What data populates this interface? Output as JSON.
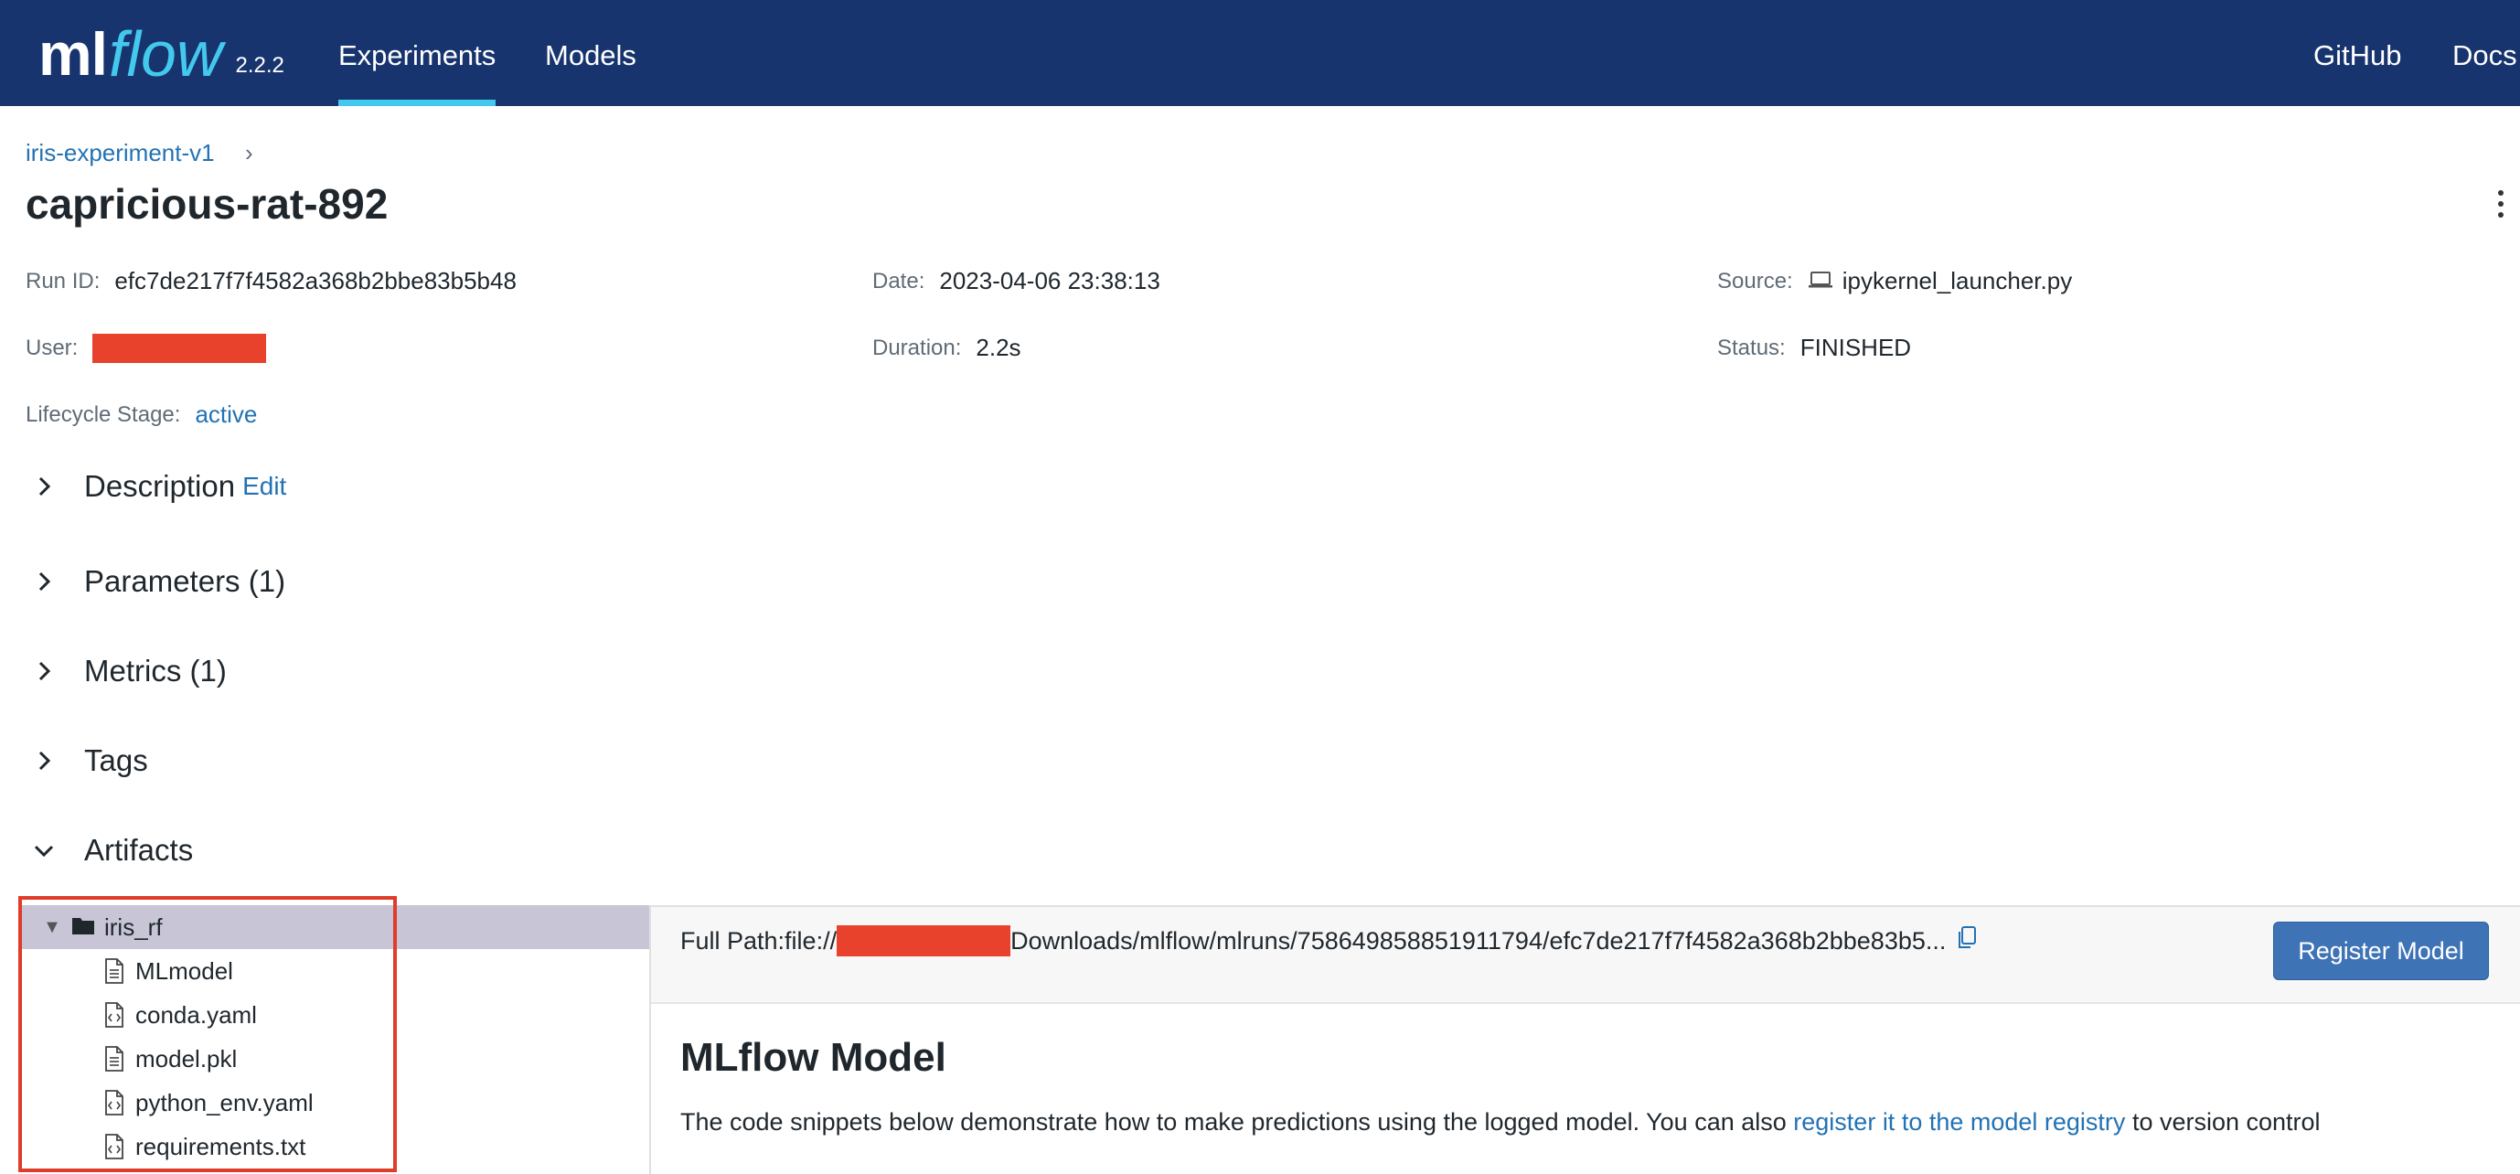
{
  "nav": {
    "logo_ml": "ml",
    "logo_flow": "flow",
    "version": "2.2.2",
    "links": [
      "Experiments",
      "Models"
    ],
    "right_links": [
      "GitHub",
      "Docs"
    ]
  },
  "breadcrumb": {
    "experiment": "iris-experiment-v1",
    "separator": "›"
  },
  "run": {
    "title": "capricious-rat-892",
    "run_id_label": "Run ID:",
    "run_id": "efc7de217f7f4582a368b2bbe83b5b48",
    "date_label": "Date:",
    "date": "2023-04-06 23:38:13",
    "source_label": "Source:",
    "source": "ipykernel_launcher.py",
    "user_label": "User:",
    "duration_label": "Duration:",
    "duration": "2.2s",
    "status_label": "Status:",
    "status": "FINISHED",
    "lifecycle_label": "Lifecycle Stage:",
    "lifecycle": "active"
  },
  "sections": {
    "description": "Description",
    "edit": "Edit",
    "parameters": "Parameters (1)",
    "metrics": "Metrics (1)",
    "tags": "Tags",
    "artifacts": "Artifacts"
  },
  "artifacts": {
    "folder": "iris_rf",
    "files": [
      {
        "name": "MLmodel",
        "icon": "file-text-icon"
      },
      {
        "name": "conda.yaml",
        "icon": "file-code-icon"
      },
      {
        "name": "model.pkl",
        "icon": "file-text-icon"
      },
      {
        "name": "python_env.yaml",
        "icon": "file-code-icon"
      },
      {
        "name": "requirements.txt",
        "icon": "file-code-icon"
      }
    ],
    "path_prefix": "Full Path:file://",
    "path_suffix": "Downloads/mlflow/mlruns/758649858851911794/efc7de217f7f4582a368b2bbe83b5...",
    "register_button": "Register Model",
    "model_title": "MLflow Model",
    "model_desc_start": "The code snippets below demonstrate how to make predictions using the logged model. You can also ",
    "model_desc_link": "register it to the model registry",
    "model_desc_end": " to version control"
  },
  "colors": {
    "nav_bg": "#18346e",
    "accent": "#43c9ed",
    "link": "#2272b4",
    "redaction": "#e8412c",
    "button": "#3e73b6",
    "selected_row": "#c8c5d6"
  }
}
